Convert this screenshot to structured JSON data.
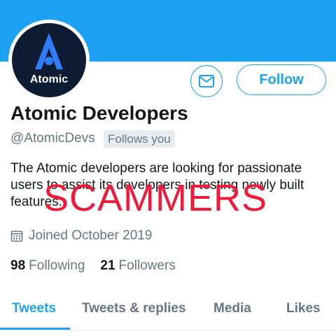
{
  "profile": {
    "avatar_text": "Atomic",
    "name": "Atomic Developers",
    "handle": "@AtomicDevs",
    "follows_you_badge": "Follows you",
    "bio": "The Atomic developers are looking for passionate users to assist its developers in testing newly built features.",
    "joined": "Joined October 2019"
  },
  "actions": {
    "message_icon": "envelope-icon",
    "follow_label": "Follow"
  },
  "stats": {
    "following_count": "98",
    "following_label": "Following",
    "followers_count": "21",
    "followers_label": "Followers"
  },
  "overlay": {
    "stamp_text": "SCAMMERS",
    "stamp_color": "#ec1c3a"
  },
  "tabs": [
    {
      "label": "Tweets",
      "active": true
    },
    {
      "label": "Tweets & replies",
      "active": false
    },
    {
      "label": "Media",
      "active": false
    },
    {
      "label": "Likes",
      "active": false
    }
  ],
  "colors": {
    "accent": "#1da1f2",
    "text_primary": "#14171a",
    "text_secondary": "#657786",
    "avatar_bg": "#0f1a33"
  }
}
